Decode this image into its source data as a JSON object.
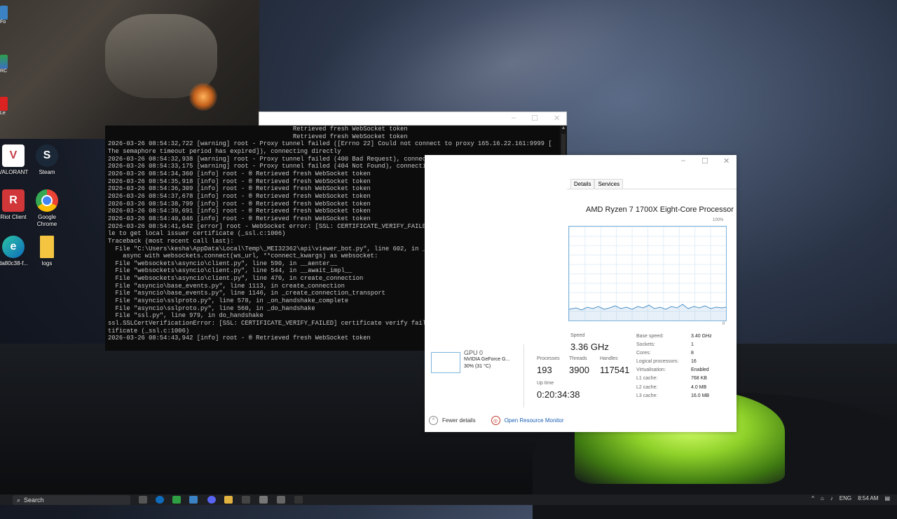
{
  "desktop": {
    "icons": [
      {
        "label": "VALORANT",
        "glyph": "V",
        "color": "#c43a47"
      },
      {
        "label": "Steam",
        "glyph": "S",
        "color": "#1b2838"
      },
      {
        "label": "Riot Client",
        "glyph": "R",
        "color": "#d13639"
      },
      {
        "label": "Google Chrome",
        "glyph": "",
        "color": "#ea4335"
      },
      {
        "label": "da80c38-f...",
        "glyph": "e",
        "color": "#0f6cbd"
      },
      {
        "label": "logs",
        "glyph": "",
        "color": "#f5c542"
      }
    ],
    "edge_labels": [
      "Fo",
      "RC",
      "Le"
    ]
  },
  "console": {
    "title_controls": [
      "–",
      "☐",
      "✕"
    ],
    "lines": [
      "                                                  Retrieved fresh WebSocket token",
      "                                                  Retrieved fresh WebSocket token",
      "2026-03-26 08:54:32,722 [warning] root - Proxy tunnel failed ([Errno 22] Could not connect to proxy 165.16.22.161:9999 [",
      "The semaphore timeout period has expired]), connecting directly",
      "2026-03-26 08:54:32,938 [warning] root - Proxy tunnel failed (400 Bad Request), connecting directly",
      "2026-03-26 08:54:33,175 [warning] root - Proxy tunnel failed (404 Not Found), connecting directly",
      "2026-03-26 08:54:34,360 [info] root - ® Retrieved fresh WebSocket token",
      "2026-03-26 08:54:35,918 [info] root - ® Retrieved fresh WebSocket token",
      "2026-03-26 08:54:36,309 [info] root - ® Retrieved fresh WebSocket token",
      "2026-03-26 08:54:37,678 [info] root - ® Retrieved fresh WebSocket token",
      "2026-03-26 08:54:38,799 [info] root - ® Retrieved fresh WebSocket token",
      "2026-03-26 08:54:39,691 [info] root - ® Retrieved fresh WebSocket token",
      "2026-03-26 08:54:40,046 [info] root - ® Retrieved fresh WebSocket token",
      "2026-03-26 08:54:41,642 [error] root - WebSocket error: [SSL: CERTIFICATE_VERIFY_FAILED] certificate verify failed: unab",
      "le to get local issuer certificate (_ssl.c:1006)",
      "Traceback (most recent call last):",
      "  File \"C:\\Users\\kesha\\AppData\\Local\\Temp\\_MEI32362\\api\\viewer_bot.py\", line 602, in _websocket_worker",
      "    async with websockets.connect(ws_url, **connect_kwargs) as websocket:",
      "  File \"websockets\\asyncio\\client.py\", line 590, in __aenter__",
      "  File \"websockets\\asyncio\\client.py\", line 544, in __await_impl__",
      "  File \"websockets\\asyncio\\client.py\", line 470, in create_connection",
      "  File \"asyncio\\base_events.py\", line 1113, in create_connection",
      "  File \"asyncio\\base_events.py\", line 1146, in _create_connection_transport",
      "  File \"asyncio\\sslproto.py\", line 578, in _on_handshake_complete",
      "  File \"asyncio\\sslproto.py\", line 560, in _do_handshake",
      "  File \"ssl.py\", line 979, in do_handshake",
      "ssl.SSLCertVerificationError: [SSL: CERTIFICATE_VERIFY_FAILED] certificate verify failed: unable to get local issuer cer",
      "tificate (_ssl.c:1006)",
      "2026-03-26 08:54:43,942 [info] root - ® Retrieved fresh WebSocket token"
    ]
  },
  "task_manager": {
    "title_controls": [
      "–",
      "☐",
      "✕"
    ],
    "tabs": [
      "Details",
      "Services"
    ],
    "cpu_name": "AMD Ryzen 7 1700X Eight-Core Processor",
    "graph_max": "100%",
    "graph_min": "0",
    "gpu": {
      "name": "GPU 0",
      "model": "NVIDIA GeForce G...",
      "usage": "30% (31 °C)"
    },
    "speed_label": "Speed",
    "speed_value": "3.36 GHz",
    "processes_label": "Processes",
    "processes_value": "193",
    "threads_label": "Threads",
    "threads_value": "3900",
    "handles_label": "Handles",
    "handles_value": "117541",
    "uptime_label": "Up time",
    "uptime_value": "0:20:34:38",
    "specs": [
      {
        "k": "Base speed:",
        "v": "3.40 GHz"
      },
      {
        "k": "Sockets:",
        "v": "1"
      },
      {
        "k": "Cores:",
        "v": "8"
      },
      {
        "k": "Logical processors:",
        "v": "16"
      },
      {
        "k": "Virtualisation:",
        "v": "Enabled"
      },
      {
        "k": "L1 cache:",
        "v": "768 KB"
      },
      {
        "k": "L2 cache:",
        "v": "4.0 MB"
      },
      {
        "k": "L3 cache:",
        "v": "16.0 MB"
      }
    ],
    "fewer_details": "Fewer details",
    "resource_monitor": "Open Resource Monitor"
  },
  "taskbar": {
    "search_placeholder": "Search",
    "language": "ENG",
    "time": "8:54 AM"
  }
}
